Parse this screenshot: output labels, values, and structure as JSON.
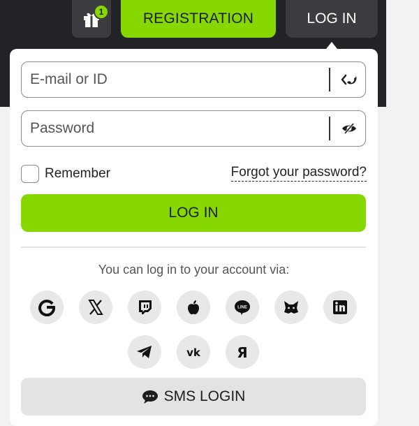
{
  "header": {
    "gift_badge_count": "1",
    "registration_label": "REGISTRATION",
    "login_label": "LOG IN"
  },
  "login_form": {
    "email": {
      "placeholder": "E-mail or ID",
      "value": ""
    },
    "password": {
      "placeholder": "Password",
      "value": ""
    },
    "remember_label": "Remember",
    "remember_checked": false,
    "forgot_label": "Forgot your password?",
    "submit_label": "LOG IN",
    "via_text": "You can log in to your account via:",
    "social_providers": [
      "google-icon",
      "x-icon",
      "twitch-icon",
      "apple-icon",
      "line-icon",
      "metamask-icon",
      "linkedin-icon",
      "telegram-icon",
      "vk-icon",
      "yandex-icon"
    ],
    "sms_label": "SMS LOGIN"
  },
  "colors": {
    "accent": "#86d800",
    "header_bg": "#222326",
    "dark_button": "#3b3c40",
    "social_bg": "#e8e8e8"
  }
}
